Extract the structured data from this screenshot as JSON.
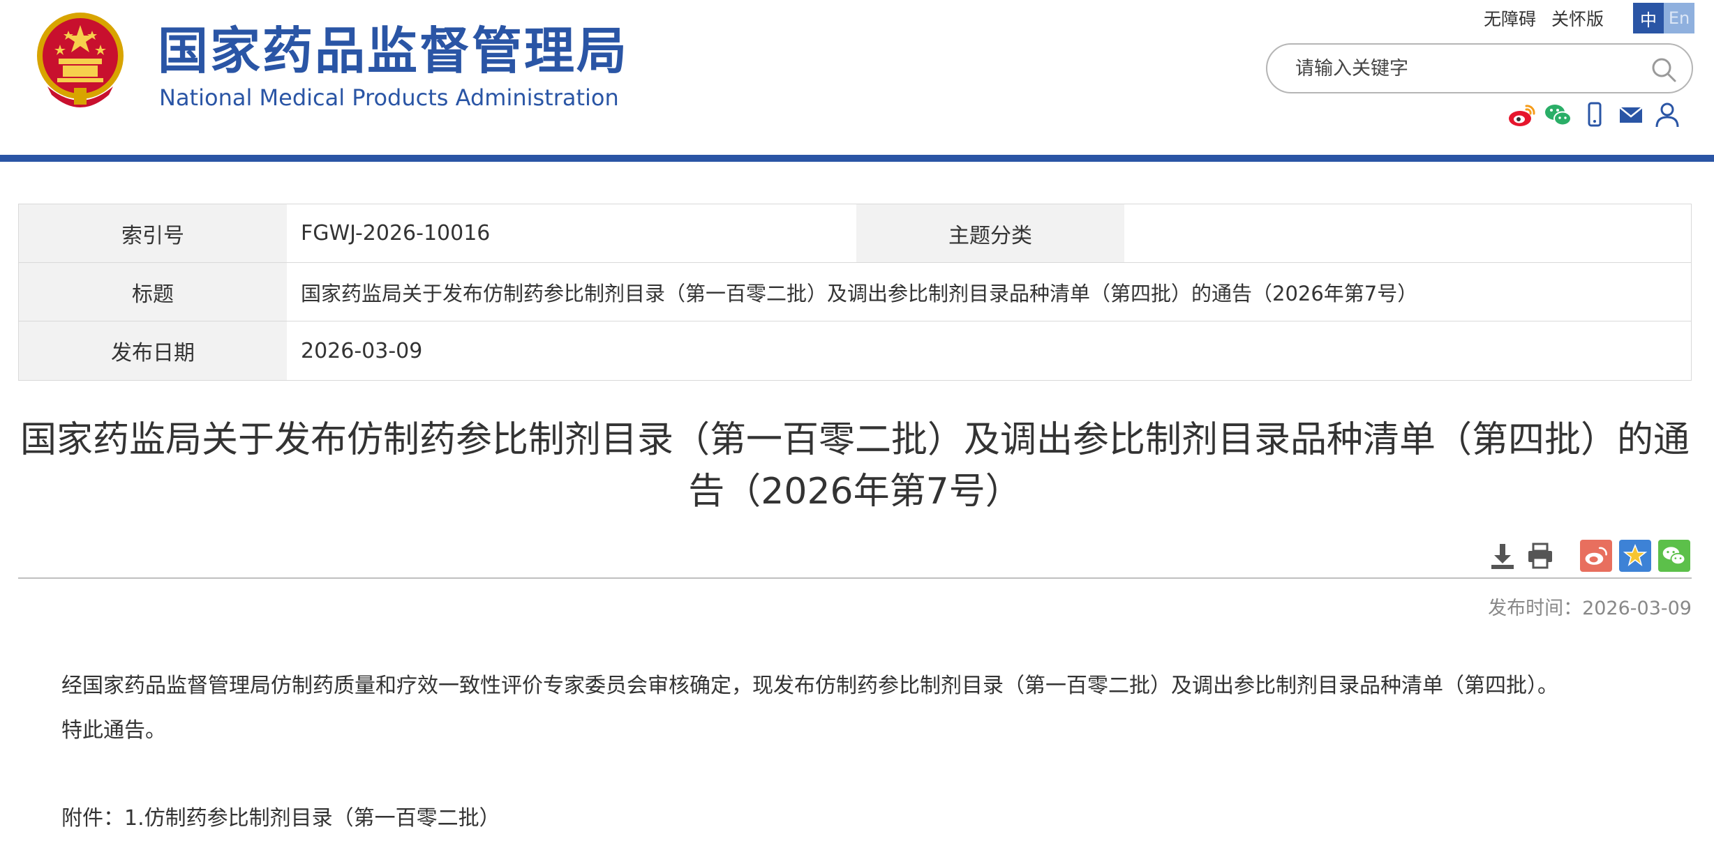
{
  "site": {
    "name_cn": "国家药品监督管理局",
    "name_en": "National Medical Products Administration",
    "emblem_icon": "national-emblem-icon",
    "brand_color": "#2a55a5"
  },
  "toplinks": {
    "accessibility": "无障碍",
    "elderly": "关怀版",
    "lang_cn": "中",
    "lang_en": "En"
  },
  "search": {
    "placeholder": "请输入关键字",
    "value": "",
    "icon": "search-icon"
  },
  "social_icons": [
    "weibo-icon",
    "wechat-icon",
    "mobile-icon",
    "mail-icon",
    "user-icon"
  ],
  "meta": {
    "index_label": "索引号",
    "index_value": "FGWJ-2026-10016",
    "topic_label": "主题分类",
    "topic_value": "",
    "title_label": "标题",
    "title_value": "国家药监局关于发布仿制药参比制剂目录（第一百零二批）及调出参比制剂目录品种清单（第四批）的通告（2026年第7号）",
    "date_label": "发布日期",
    "date_value": "2026-03-09"
  },
  "article": {
    "title": "国家药监局关于发布仿制药参比制剂目录（第一百零二批）及调出参比制剂目录品种清单（第四批）的通告（2026年第7号）",
    "publish_time": "发布时间：2026-03-09",
    "paragraph_1": "经国家药品监督管理局仿制药质量和疗效一致性评价专家委员会审核确定，现发布仿制药参比制剂目录（第一百零二批）及调出参比制剂目录品种清单（第四批）。",
    "paragraph_2": "特此通告。",
    "attachment_1": "附件：1.仿制药参比制剂目录（第一百零二批）"
  },
  "tools": [
    "download-icon",
    "print-icon",
    "weibo-share-icon",
    "favorite-star-icon",
    "wechat-share-icon"
  ],
  "colors": {
    "weibo_share": "#e86f5e",
    "favorite": "#3d82d6",
    "wechat_share": "#5cc04a",
    "muted_text": "#888888"
  }
}
